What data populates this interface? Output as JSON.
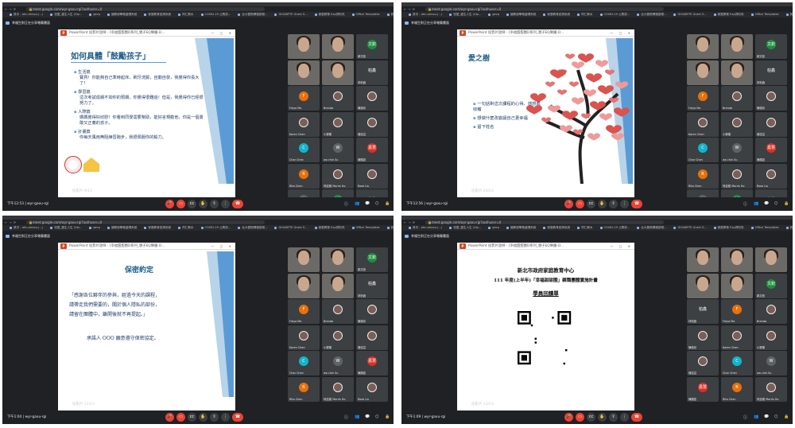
{
  "browser": {
    "url": "meet.google.com/wyr-gaxu-rgi?authuser=0",
    "bookmarks": [
      "其中 - ahn.ahnou.(...)",
      "恆愛_重生人生 (Vip...",
      "gecp",
      "國教部學務處理系統",
      "家庭教育諮詢系統",
      "同仁薪水",
      "COVID-19 公費試...",
      "台大醫院網路掛號...",
      "GIGABYTE Grant S...",
      "家庭教育 Exp資料夾",
      "Office Templates",
      "其他書籤"
    ]
  },
  "meet": {
    "presenter_label": "幸福生財正在分享螢幕畫面",
    "meeting_code": "wyr-gaxu-rgi"
  },
  "ppt_title_prefix": "PowerPoint 投影片放映 - [幸福甜甜圈D系列_親子EQ樂園-D...",
  "quadrants": [
    {
      "time": "下午12:53",
      "slide_label": "投影片 9/13",
      "slide": {
        "kind": "list",
        "title": "如何具體「鼓勵孩子」",
        "items": [
          {
            "head": "生活篇",
            "body": "寶貝！你能夠自己準時起床，刷牙洗臉，自動自發，我覺得你長大了！"
          },
          {
            "head": "學習篇",
            "body": "這次考試成績不如你的預期，你覺得很難過！但是，我覺得你已經很努力了。"
          },
          {
            "head": "人際篇",
            "body": "媽媽覺得好欣慰！你看到同學需要幫助，能好言規勸他，你是一個勇敢又正義的孩子。"
          },
          {
            "head": "計畫篇",
            "body": "你每天風雨無阻練習跑步，我很佩服你的毅力。"
          }
        ]
      }
    },
    {
      "time": "下午12:56",
      "slide_label": "投影片 10/13",
      "slide": {
        "kind": "tree",
        "title": "愛之樹",
        "items": [
          "一句話對這次課程的心得、感想或收穫",
          "想做什麼改變讓自己更幸福",
          "留下姓名"
        ]
      }
    },
    {
      "time": "下午1:04",
      "slide_label": "投影片 12/13",
      "slide": {
        "kind": "pledge",
        "title": "保密約定",
        "lines": [
          "「感謝各位夥伴的參與，經過今天的課程，",
          "請帶走我們需要的，關於個人隱私的部份，",
          "請留在團體中，離開後就不再提起。」"
        ],
        "signature": "承諾人 OOO 願意遵守保密協定。"
      }
    },
    {
      "time": "下午1:09",
      "slide_label": "投影片 13/13",
      "slide": {
        "kind": "qr",
        "lines": [
          "新北市政府家庭教育中心",
          "111 年度(上半年)「幸福甜甜圈」親職團體實施計畫"
        ],
        "subtitle": "學員回饋單"
      }
    }
  ],
  "participants": {
    "cam_names": [
      "",
      "",
      "",
      "",
      ""
    ],
    "named": [
      {
        "name": "鄒文欽",
        "initial": "文欽",
        "color": "#1e8e3e"
      },
      {
        "name": "林柏鑫",
        "initial": "柏鑫",
        "color": "#3c4043"
      },
      {
        "name": "Freya Ma",
        "initial": "F",
        "color": "#e8710a"
      },
      {
        "name": "Brenda",
        "initial": "",
        "color": "#7b5e57"
      },
      {
        "name": "陳儀珍",
        "initial": "",
        "color": "#7b5e57"
      },
      {
        "name": "Karen Chen",
        "initial": "",
        "color": "#7b5e57"
      },
      {
        "name": "小柳樹",
        "initial": "",
        "color": "#7b5e57"
      },
      {
        "name": "鍾佳芸",
        "initial": "",
        "color": "#7b5e57"
      },
      {
        "name": "Char Chen",
        "initial": "C",
        "color": "#12b5cb"
      },
      {
        "name": "wa chin Su",
        "initial": "W",
        "color": "#5f6368"
      },
      {
        "name": "陳顏如",
        "initial": "嘉慧",
        "color": "#d93025"
      },
      {
        "name": "Rita Chen",
        "initial": "R",
        "color": "#e8710a"
      },
      {
        "name": "柯廷妮 Morris Ho",
        "initial": "",
        "color": "#7b5e57"
      },
      {
        "name": "Rose Liu",
        "initial": "",
        "color": "#7b5e57"
      },
      {
        "name": "黃芊萱",
        "initial": "軒",
        "color": "#5f6368"
      }
    ]
  }
}
